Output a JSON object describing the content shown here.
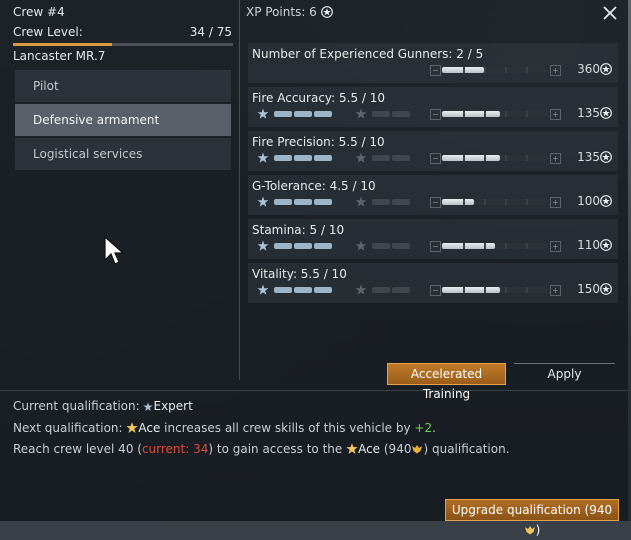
{
  "crew": {
    "title": "Crew #4",
    "level_label": "Crew Level:",
    "level_value": "34 / 75",
    "level_progress": 0.45,
    "vehicle": "Lancaster MR.7"
  },
  "tabs": [
    {
      "label": "Pilot",
      "active": false
    },
    {
      "label": "Defensive armament",
      "active": true
    },
    {
      "label": "Logistical services",
      "active": false
    }
  ],
  "xp_points": "XP Points: 6",
  "skills": [
    {
      "name": "Number of Experienced Gunners: 2 / 5",
      "cost": "360",
      "progress": 0.4,
      "show_qual": false
    },
    {
      "name": "Fire Accuracy: 5.5 / 10",
      "cost": "135",
      "progress": 0.55,
      "show_qual": true
    },
    {
      "name": "Fire Precision: 5.5 / 10",
      "cost": "135",
      "progress": 0.55,
      "show_qual": true
    },
    {
      "name": "G-Tolerance: 4.5 / 10",
      "cost": "100",
      "progress": 0.3,
      "show_qual": true
    },
    {
      "name": "Stamina: 5 / 10",
      "cost": "110",
      "progress": 0.5,
      "show_qual": true
    },
    {
      "name": "Vitality: 5.5 / 10",
      "cost": "150",
      "progress": 0.55,
      "show_qual": true
    }
  ],
  "buttons": {
    "accelerated": "Accelerated Training",
    "apply": "Apply",
    "upgrade": "Upgrade qualification (940"
  },
  "info": {
    "current_prefix": "Current qualification: ",
    "current_value": "Expert",
    "next_prefix": "Next qualification: ",
    "next_name": "Ace",
    "next_suffix": " increases all crew skills of this vehicle by ",
    "next_bonus": "+2",
    "next_end": ".",
    "reach_prefix": "Reach crew level 40 (",
    "reach_current": "current: 34",
    "reach_mid": ") to gain access to the ",
    "reach_ace": "Ace",
    "reach_cost": " (940",
    "reach_end": ") qualification."
  },
  "colors": {
    "accent_orange": "#d89a3c",
    "green": "#6fd14a",
    "red": "#e04a3a"
  },
  "icons": {
    "close": "close-icon",
    "xp": "star-icon",
    "expert": "expert-icon",
    "ace": "ace-icon",
    "eagle": "golden-eagle-icon"
  }
}
